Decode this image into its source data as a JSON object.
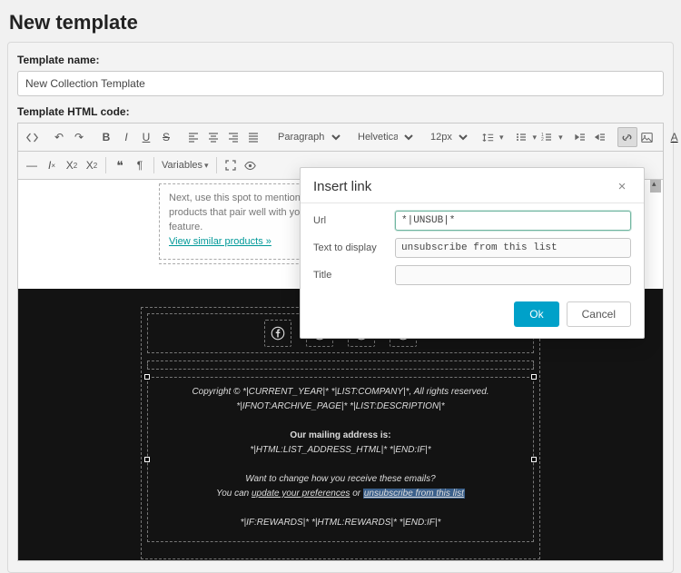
{
  "page": {
    "title": "New template"
  },
  "fields": {
    "template_name_label": "Template name:",
    "template_name_value": "New Collection Template",
    "template_html_label": "Template HTML code:"
  },
  "toolbar": {
    "paragraph": "Paragraph",
    "font_family": "Helvetica",
    "font_size": "12px",
    "variables": "Variables"
  },
  "feature": {
    "body": "Next, use this spot to mention any other products that pair well with your main feature.",
    "link": "View similar products »"
  },
  "footer": {
    "copyright": "Copyright © *|CURRENT_YEAR|* *|LIST:COMPANY|*, All rights reserved.",
    "archive": "*|IFNOT:ARCHIVE_PAGE|* *|LIST:DESCRIPTION|*",
    "address_heading": "Our mailing address is:",
    "address": "*|HTML:LIST_ADDRESS_HTML|* *|END:IF|*",
    "change_q": "Want to change how you receive these emails?",
    "change_a_prefix": "You can ",
    "update_pref": "update your preferences",
    "or": " or ",
    "unsub": "unsubscribe from this list",
    "rewards": "*|IF:REWARDS|* *|HTML:REWARDS|* *|END:IF|*"
  },
  "modal": {
    "title": "Insert link",
    "url_label": "Url",
    "url_value": "*|UNSUB|*",
    "text_label": "Text to display",
    "text_value": "unsubscribe from this list",
    "title_label": "Title",
    "title_value": "",
    "ok": "Ok",
    "cancel": "Cancel"
  }
}
